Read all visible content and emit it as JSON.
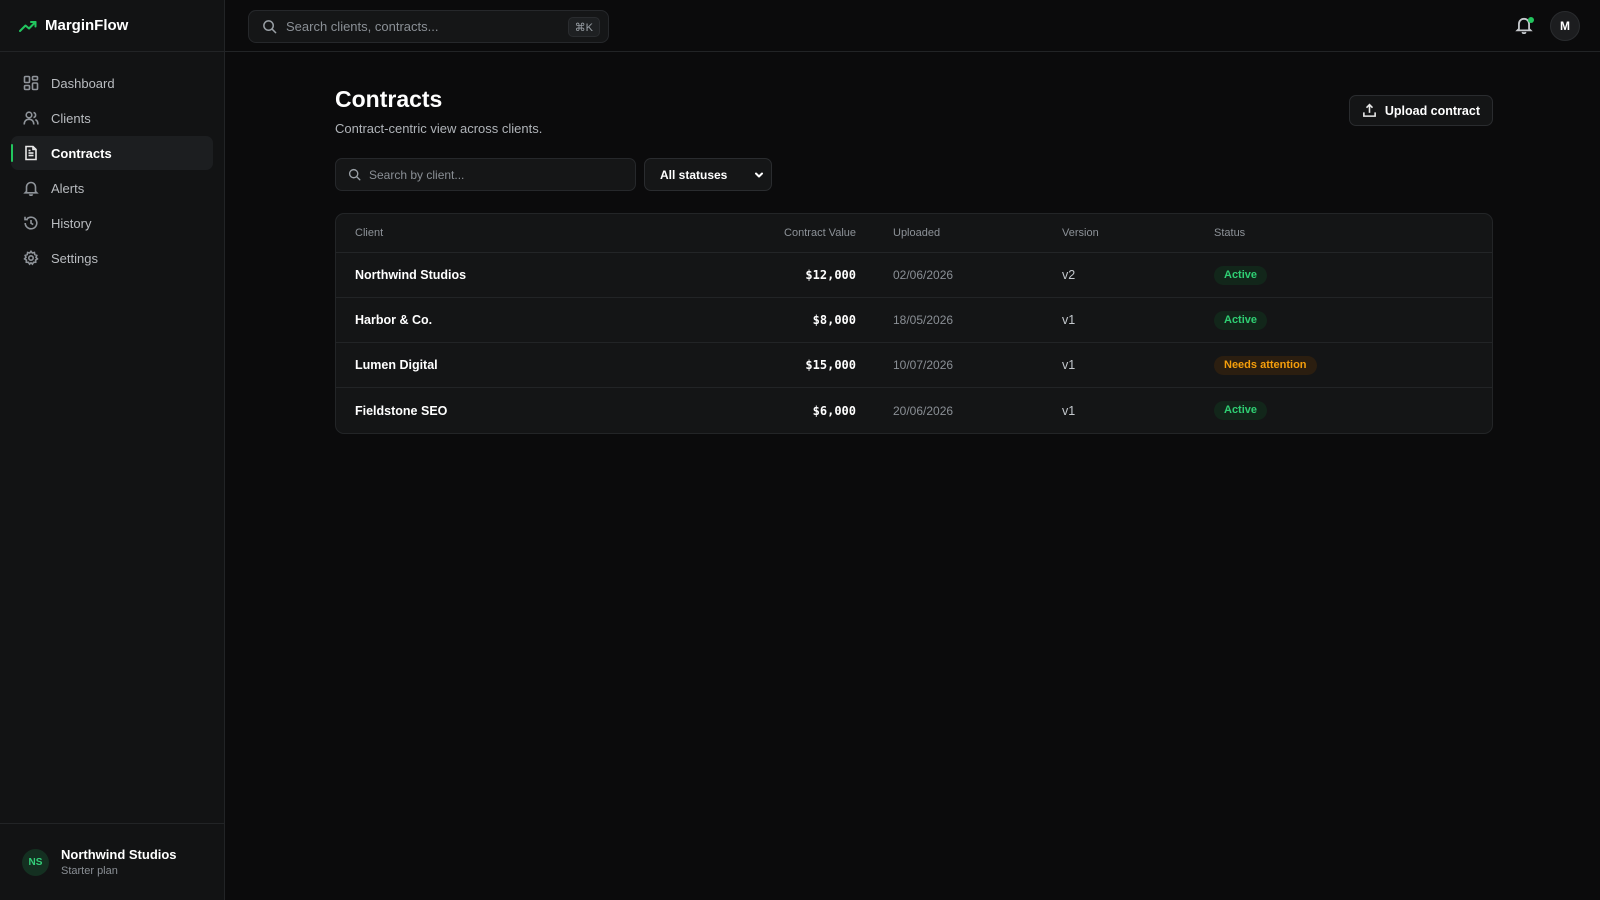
{
  "brand": {
    "name": "MarginFlow",
    "accent": "#22c55e"
  },
  "topbar": {
    "search_placeholder": "Search clients, contracts...",
    "shortcut": "⌘K",
    "user_initial": "M"
  },
  "sidebar": {
    "items": [
      {
        "label": "Dashboard",
        "icon": "dashboard-icon",
        "active": false
      },
      {
        "label": "Clients",
        "icon": "users-icon",
        "active": false
      },
      {
        "label": "Contracts",
        "icon": "document-icon",
        "active": true
      },
      {
        "label": "Alerts",
        "icon": "bell-icon",
        "active": false
      },
      {
        "label": "History",
        "icon": "history-icon",
        "active": false
      },
      {
        "label": "Settings",
        "icon": "gear-icon",
        "active": false
      }
    ],
    "footer": {
      "initials": "NS",
      "org_name": "Northwind Studios",
      "plan": "Starter plan"
    }
  },
  "page": {
    "title": "Contracts",
    "subtitle": "Contract-centric view across clients.",
    "upload_label": "Upload contract"
  },
  "filters": {
    "search_placeholder": "Search by client...",
    "status_selected": "All statuses"
  },
  "table": {
    "headers": {
      "client": "Client",
      "value": "Contract Value",
      "uploaded": "Uploaded",
      "version": "Version",
      "status": "Status"
    },
    "rows": [
      {
        "client": "Northwind Studios",
        "value": "$12,000",
        "uploaded": "02/06/2026",
        "version": "v2",
        "status": "Active",
        "status_type": "active"
      },
      {
        "client": "Harbor & Co.",
        "value": "$8,000",
        "uploaded": "18/05/2026",
        "version": "v1",
        "status": "Active",
        "status_type": "active"
      },
      {
        "client": "Lumen Digital",
        "value": "$15,000",
        "uploaded": "10/07/2026",
        "version": "v1",
        "status": "Needs attention",
        "status_type": "attention"
      },
      {
        "client": "Fieldstone SEO",
        "value": "$6,000",
        "uploaded": "20/06/2026",
        "version": "v1",
        "status": "Active",
        "status_type": "active"
      }
    ]
  }
}
